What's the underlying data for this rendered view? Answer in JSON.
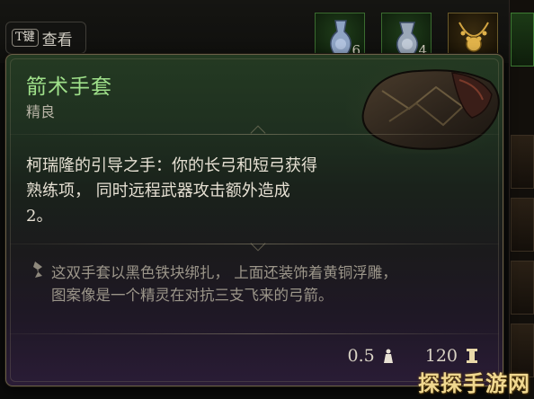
{
  "hotkey": {
    "key_label": "T键",
    "action_label": "查看"
  },
  "inventory": {
    "slots": [
      {
        "count": "6"
      },
      {
        "count": "4"
      },
      {
        "count": ""
      }
    ]
  },
  "tooltip": {
    "name": "箭术手套",
    "rarity": "精良",
    "passive_line1": "柯瑞隆的引导之手：你的长弓和短弓获得",
    "passive_line2": "熟练项， 同时远程武器攻击额外造成",
    "passive_line3": "2。",
    "flavor_line1": "这双手套以黑色铁块绑扎， 上面还装饰着黄铜浮雕，",
    "flavor_line2": "图案像是一个精灵在对抗三支飞来的弓箭。",
    "weight": "0.5",
    "value": "120"
  },
  "colors": {
    "rarity_name": "#9fe08a",
    "header_green": "#243a22",
    "footer_purple": "#2a1c36"
  },
  "icons": [
    "weight-icon",
    "gold-icon",
    "flavor-quill-icon",
    "gauntlet-icon"
  ],
  "watermark": "探探手游网"
}
